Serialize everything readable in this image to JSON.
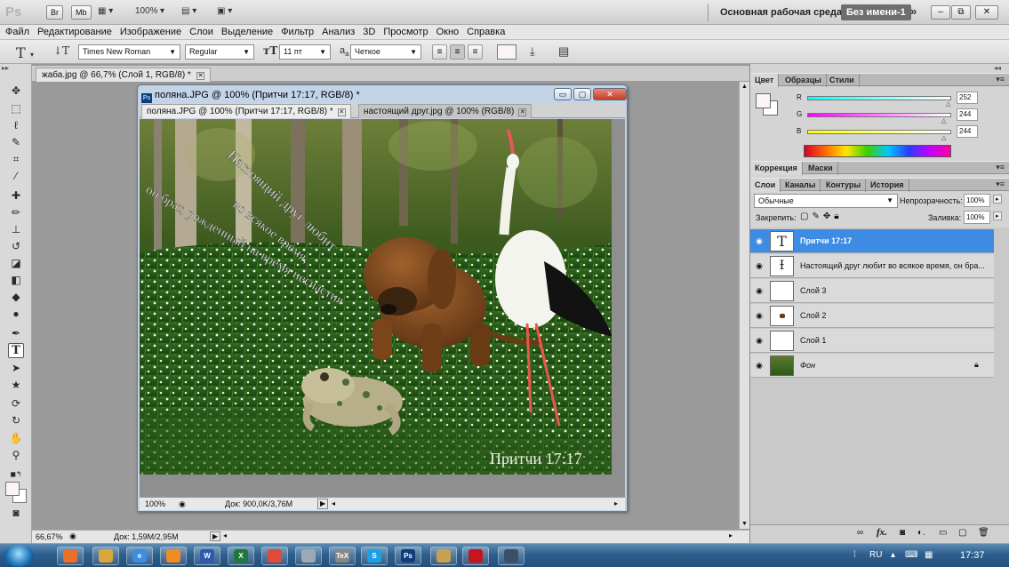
{
  "app": {
    "logo": "Ps",
    "bridge_button": "Br",
    "minibridge_button": "Mb",
    "zoom_readout": "100%",
    "workspace_label": "Основная рабочая среда",
    "workspace_active": "Без имени-1",
    "more": "»"
  },
  "menu": [
    "Файл",
    "Редактирование",
    "Изображение",
    "Слои",
    "Выделение",
    "Фильтр",
    "Анализ",
    "3D",
    "Просмотр",
    "Окно",
    "Справка"
  ],
  "options": {
    "font_family": "Times New Roman",
    "font_style": "Regular",
    "font_size": "11 пт",
    "aa_prefix": "a",
    "aa_prefix_sub": "a",
    "antialias": "Четкое"
  },
  "back_document": {
    "tab": "жаба.jpg @ 66,7% (Слой 1, RGB/8) *",
    "zoom": "66,67%",
    "doc_size": "Док: 1,59M/2,95M"
  },
  "document": {
    "title": "поляна.JPG @ 100% (Притчи 17:17, RGB/8) *",
    "tabs": [
      {
        "label": "поляна.JPG @ 100% (Притчи 17:17, RGB/8) *",
        "active": true
      },
      {
        "label": "настоящий друг.jpg @ 100% (RGB/8)",
        "active": false
      }
    ],
    "zoom": "100%",
    "doc_size": "Док: 900,0K/3,76M",
    "ps_badge": "Ps"
  },
  "artwork": {
    "text_line_1": "Настоящий друг любит",
    "text_line_2": "во всякое время,",
    "text_line_3": "он брат, рожденный на время несчастия",
    "signature": "Притчи 17:17"
  },
  "color_panel": {
    "tabs": [
      "Цвет",
      "Образцы",
      "Стили"
    ],
    "r_label": "R",
    "g_label": "G",
    "b_label": "B",
    "r": "252",
    "g": "244",
    "b": "244",
    "r_fraction": 0.988,
    "g_fraction": 0.957,
    "b_fraction": 0.957
  },
  "correction_panel": {
    "tabs": [
      "Коррекция",
      "Маски"
    ]
  },
  "layers_panel": {
    "tabs": [
      "Слои",
      "Каналы",
      "Контуры",
      "История"
    ],
    "blend_mode": "Обычные",
    "opacity_label": "Непрозрачность:",
    "opacity": "100%",
    "lock_label": "Закрепить:",
    "fill_label": "Заливка:",
    "fill": "100%",
    "layers": [
      {
        "name": "Притчи 17:17",
        "type": "text",
        "selected": true
      },
      {
        "name": "Настоящий друг любит  во всякое время,  он бра...",
        "type": "warp-text",
        "selected": false
      },
      {
        "name": "Слой 3",
        "type": "transparent",
        "selected": false
      },
      {
        "name": "Слой 2",
        "type": "transparent",
        "selected": false
      },
      {
        "name": "Слой 1",
        "type": "transparent",
        "selected": false
      },
      {
        "name": "Фон",
        "type": "background",
        "selected": false,
        "locked": true
      }
    ]
  },
  "taskbar": {
    "lang": "RU",
    "clock": "17:37",
    "apps": [
      "firefox-icon",
      "explorer-icon",
      "ie-icon",
      "media-icon",
      "word-icon",
      "excel-icon",
      "chrome-icon",
      "files-icon",
      "tex-icon",
      "skype-icon",
      "photoshop-icon",
      "paint-icon",
      "acrobat-icon",
      "window-icon"
    ],
    "app_letters": [
      "",
      "",
      "e",
      "",
      "W",
      "X",
      "",
      "",
      "TeX",
      "S",
      "Ps",
      "",
      "",
      ""
    ]
  },
  "colors": {
    "accent_selection": "#3d8be3",
    "foreground_swatch": "#fcf4f4"
  }
}
